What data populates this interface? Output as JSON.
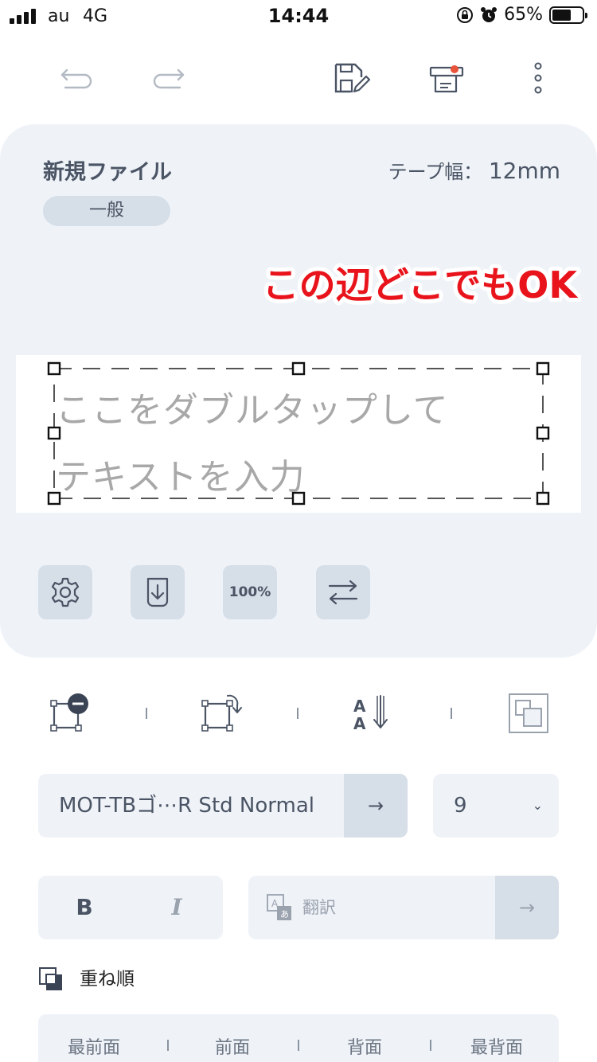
{
  "status_bar": {
    "carrier": "au",
    "network": "4G",
    "time": "14:44",
    "battery_percent": "65%",
    "battery_level": 0.65,
    "icons": [
      "rotation-lock-icon",
      "alarm-icon",
      "battery-icon"
    ]
  },
  "toolbar": {
    "icons": [
      "undo-icon",
      "redo-icon",
      "save-icon",
      "print-icon",
      "more-icon"
    ],
    "print_badge_color": "#e8533a"
  },
  "canvas": {
    "file_name": "新規ファイル",
    "tape_width_label": "テープ幅：",
    "tape_width_value": "12mm",
    "category": "一般",
    "annotation": "この辺どこでもOK",
    "annotation_color": "#e8131b",
    "placeholder": "ここをダブルタップして\nテキストを入力",
    "tools": {
      "zoom_label": "100%",
      "icons": [
        "settings-icon",
        "import-icon",
        "zoom-icon",
        "swap-icon"
      ]
    }
  },
  "properties": {
    "object_icons": [
      "remove-object-icon",
      "rotate-object-icon",
      "text-direction-icon",
      "group-icon"
    ],
    "font_name": "MOT-TBゴ⋯R Std Normal",
    "font_arrow": "→",
    "font_size": "9",
    "font_size_chevron": "⌄",
    "bold_label": "B",
    "italic_label": "I",
    "translate_label": "翻訳",
    "translate_arrow": "→",
    "order_title": "重ね順",
    "order_options": [
      "最前面",
      "前面",
      "背面",
      "最背面"
    ]
  },
  "colors": {
    "card_bg": "#eff3f8",
    "button_bg": "#d6dee8",
    "text_dark": "#4a5464",
    "placeholder": "#a8a8a8"
  }
}
